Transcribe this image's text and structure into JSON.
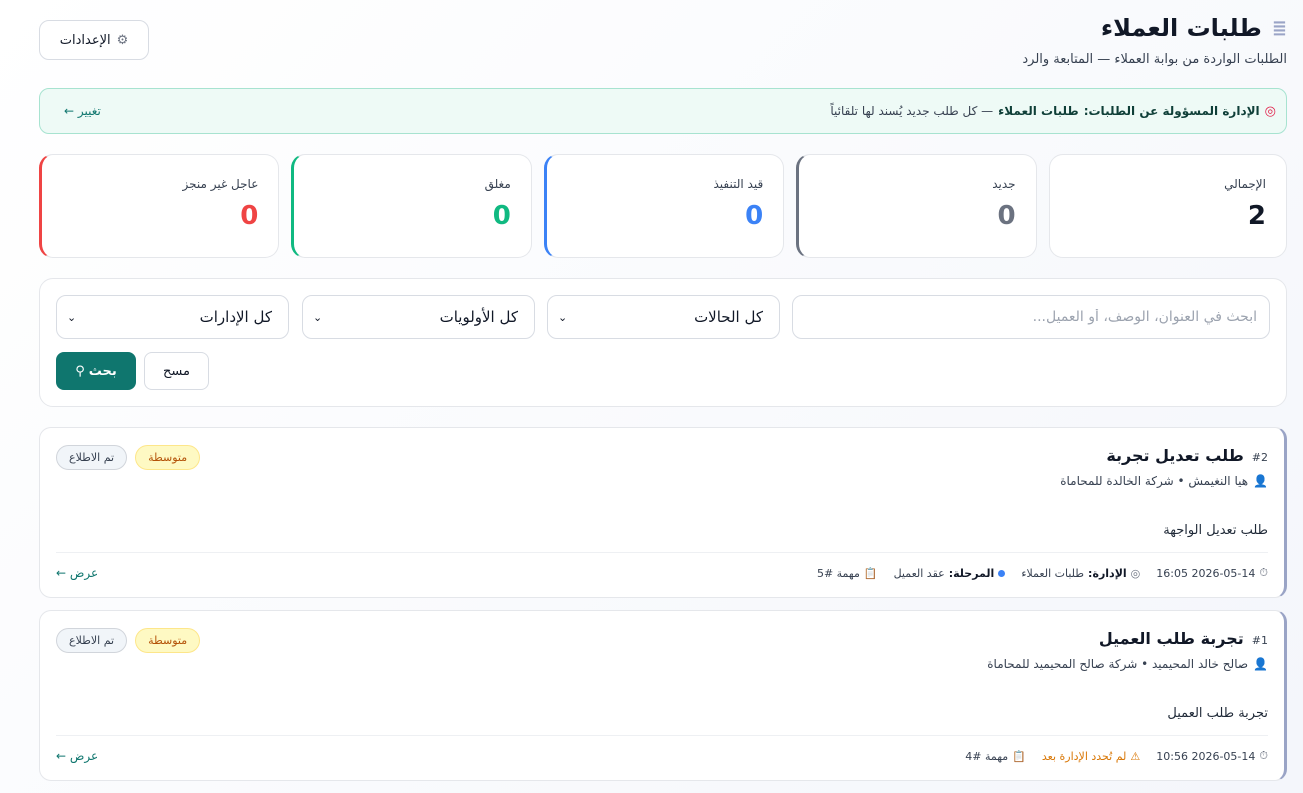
{
  "header": {
    "title": "طلبات العملاء",
    "title_icon": "speed-lines-icon",
    "subtitle": "الطلبات الواردة من بوابة العملاء — المتابعة والرد",
    "settings_label": "الإعدادات",
    "settings_icon": "gear-icon"
  },
  "banner": {
    "icon": "target-icon",
    "label": "الإدارة المسؤولة عن الطلبات:",
    "dept_name": "طلبات العملاء",
    "note": "— كل طلب جديد يُسند لها تلقائياً",
    "change_label": "تغيير ←"
  },
  "stats": [
    {
      "label": "الإجمالي",
      "value": "2"
    },
    {
      "label": "جديد",
      "value": "0"
    },
    {
      "label": "قيد التنفيذ",
      "value": "0"
    },
    {
      "label": "مغلق",
      "value": "0"
    },
    {
      "label": "عاجل غير منجز",
      "value": "0"
    }
  ],
  "filters": {
    "search_placeholder": "ابحث في العنوان، الوصف، أو العميل...",
    "status_value": "كل الحالات",
    "priority_value": "كل الأولويات",
    "department_value": "كل الإدارات",
    "search_label": "بحث",
    "clear_label": "مسح"
  },
  "requests": [
    {
      "number": "#2",
      "title": "طلب تعديل تجربة",
      "client": "هيا النغيمش • شركة الخالدة للمحاماة",
      "description": "طلب تعديل الواجهة",
      "badge_status": "تم الاطلاع",
      "badge_priority": "متوسطة",
      "timestamp": "2026-05-14 16:05",
      "dept_label": "الإدارة:",
      "dept_value": "طلبات العملاء",
      "stage_label": "المرحلة:",
      "stage_value": "عقد العميل",
      "task": "مهمة #5",
      "view_label": "عرض ←"
    },
    {
      "number": "#1",
      "title": "تجربة طلب العميل",
      "client": "صالح خالد المحيميد • شركة صالح المحيميد للمحاماة",
      "description": "تجربة طلب العميل",
      "badge_status": "تم الاطلاع",
      "badge_priority": "متوسطة",
      "timestamp": "2026-05-14 10:56",
      "warning": "لم تُحدد الإدارة بعد",
      "task": "مهمة #4",
      "view_label": "عرض ←"
    }
  ]
}
